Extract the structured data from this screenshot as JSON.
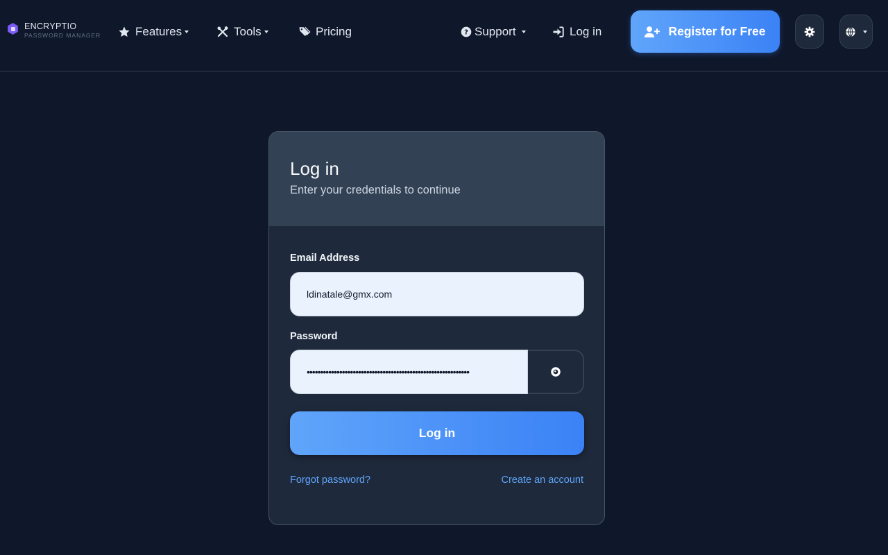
{
  "brand": {
    "name": "ENCRYPTIO",
    "tagline": "PASSWORD MANAGER"
  },
  "nav": {
    "features": "Features",
    "tools": "Tools",
    "pricing": "Pricing",
    "support": "Support",
    "login": "Log in",
    "register": "Register for Free"
  },
  "icons": {
    "features": "star-icon",
    "tools": "tools-icon",
    "pricing": "tags-icon",
    "support": "question-circle-icon",
    "login": "sign-in-icon",
    "register": "user-plus-icon",
    "theme": "gear-icon",
    "language": "globe-icon"
  },
  "card": {
    "title": "Log in",
    "subtitle": "Enter your credentials to continue",
    "email_label": "Email Address",
    "email_value": "ldinatale@gmx.com",
    "password_label": "Password",
    "password_value": "••••••••••••••••••••••••••••••••••••••••••••••••••••••••••••",
    "submit_label": "Log in",
    "forgot_link": "Forgot password?",
    "create_link": "Create an account"
  },
  "colors": {
    "background": "#0f172a",
    "card": "#1e293b",
    "card_header": "#334155",
    "accent": "#3b82f6",
    "link": "#60a5fa",
    "brand_logo": "#7c5cf5"
  }
}
